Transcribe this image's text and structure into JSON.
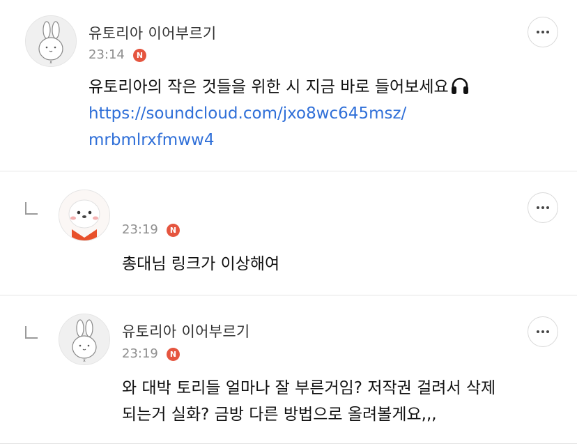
{
  "comments": [
    {
      "author": "유토리아 이어부르기",
      "time": "23:14",
      "badge": "N",
      "text": "유토리아의 작은 것들을 위한 시 지금 바로 들어보세요",
      "link_line1": "https://soundcloud.com/jxo8wc645msz/",
      "link_line2": "mrbmlrxfmww4"
    },
    {
      "author": "",
      "time": "23:19",
      "badge": "N",
      "text": "총대님 링크가 이상해여"
    },
    {
      "author": "유토리아 이어부르기",
      "time": "23:19",
      "badge": "N",
      "text_line1": "와 대박 토리들 얼마나 잘 부른거임? 저작권 걸려서 삭제",
      "text_line2": "되는거 실화? 금방 다른 방법으로 올려볼게요,,,"
    }
  ],
  "icons": {
    "more": "more-dots-icon",
    "reply": "reply-arrow-icon",
    "headphones": "headphones-icon"
  },
  "colors": {
    "link": "#2f6fd8",
    "badge": "#e5553f",
    "timestamp": "#8e8e8e"
  }
}
